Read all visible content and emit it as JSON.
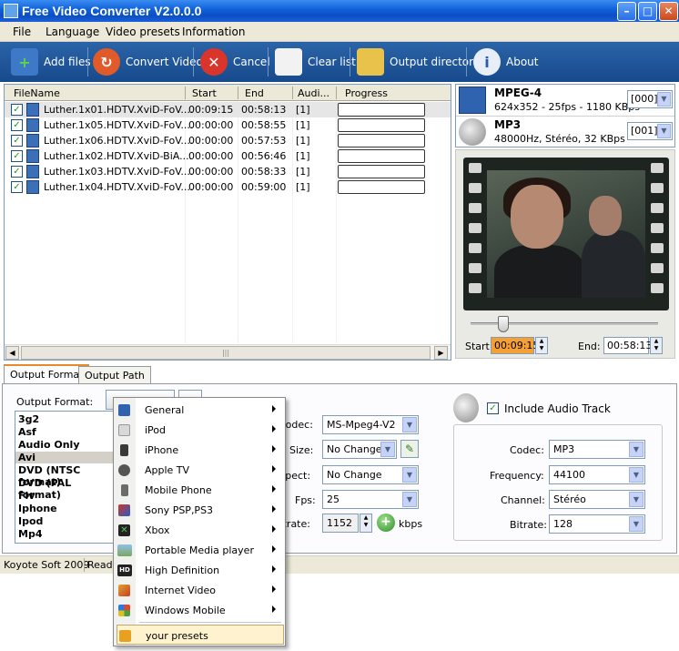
{
  "window": {
    "title": "Free Video Converter V2.0.0.0"
  },
  "menu": [
    "File",
    "Language",
    "Video presets",
    "Information"
  ],
  "toolbar": {
    "add_files": "Add files",
    "convert_video": "Convert Video",
    "cancel": "Cancel",
    "clear_list": "Clear list",
    "output_directory": "Output directory",
    "about": "About"
  },
  "filelist": {
    "columns": [
      "FileName",
      "Start",
      "End",
      "Audi...",
      "Progress"
    ],
    "rows": [
      {
        "name": "Luther.1x01.HDTV.XviD-FoV....",
        "start": "00:09:15",
        "end": "00:58:13",
        "audio": "[1]",
        "checked": "✓"
      },
      {
        "name": "Luther.1x05.HDTV.XviD-FoV....",
        "start": "00:00:00",
        "end": "00:58:55",
        "audio": "[1]",
        "checked": "✓"
      },
      {
        "name": "Luther.1x06.HDTV.XviD-FoV....",
        "start": "00:00:00",
        "end": "00:57:53",
        "audio": "[1]",
        "checked": "✓"
      },
      {
        "name": "Luther.1x02.HDTV.XviD-BiA....",
        "start": "00:00:00",
        "end": "00:56:46",
        "audio": "[1]",
        "checked": "✓"
      },
      {
        "name": "Luther.1x03.HDTV.XviD-FoV....",
        "start": "00:00:00",
        "end": "00:58:33",
        "audio": "[1]",
        "checked": "✓"
      },
      {
        "name": "Luther.1x04.HDTV.XviD-FoV....",
        "start": "00:00:00",
        "end": "00:59:00",
        "audio": "[1]",
        "checked": "✓"
      }
    ]
  },
  "streams": {
    "video": {
      "name": "MPEG-4",
      "desc": "624x352 - 25fps - 1180 KBps",
      "track": "[000]"
    },
    "audio": {
      "name": "MP3",
      "desc": "48000Hz, Stéréo, 32 KBps",
      "track": "[001]"
    }
  },
  "preview": {
    "start_label": "Start:",
    "start_value": "00:09:15",
    "end_label": "End:",
    "end_value": "00:58:13"
  },
  "tabs": {
    "output_format": "Output Format",
    "output_path": "Output Path"
  },
  "output": {
    "format_label": "Output Format:",
    "formats": [
      "3g2",
      "Asf",
      "Audio Only",
      "Avi",
      "DVD (NTSC format)",
      "DVD (PAL format)",
      "Flv",
      "Iphone",
      "Ipod",
      "Mp4"
    ],
    "selected_format": "Avi",
    "video": {
      "codec_label": "Codec:",
      "codec_value": "MS-Mpeg4-V2",
      "size_label": "Size:",
      "size_value": "No Change",
      "aspect_label": "Aspect:",
      "aspect_value": "No Change",
      "fps_label": "Fps:",
      "fps_value": "25",
      "bitrate_label": "Bitrate:",
      "bitrate_value": "1152",
      "bitrate_unit": "kbps"
    },
    "audio": {
      "include_label": "Include Audio Track",
      "codec_label": "Codec:",
      "codec_value": "MP3",
      "frequency_label": "Frequency:",
      "frequency_value": "44100",
      "channel_label": "Channel:",
      "channel_value": "Stéréo",
      "bitrate_label": "Bitrate:",
      "bitrate_value": "128"
    }
  },
  "statusbar": {
    "company": "Koyote Soft 2009",
    "status": "Read"
  },
  "presets_menu": [
    {
      "label": "General",
      "icon": "film-icon",
      "color": "#2f63b0"
    },
    {
      "label": "iPod",
      "icon": "ipod-icon",
      "color": "#d8d8d8"
    },
    {
      "label": "iPhone",
      "icon": "iphone-icon",
      "color": "#3a3a3a"
    },
    {
      "label": "Apple TV",
      "icon": "apple-icon",
      "color": "#555555"
    },
    {
      "label": "Mobile Phone",
      "icon": "mobile-phone-icon",
      "color": "#6b6b6b"
    },
    {
      "label": "Sony PSP,PS3",
      "icon": "playstation-icon",
      "color": "#c83a2a"
    },
    {
      "label": "Xbox",
      "icon": "xbox-icon",
      "color": "#2c7a2c"
    },
    {
      "label": "Portable Media player",
      "icon": "media-player-icon",
      "color": "#8aa870"
    },
    {
      "label": "High Definition",
      "icon": "hd-icon",
      "color": "#222222"
    },
    {
      "label": "Internet Video",
      "icon": "internet-video-icon",
      "color": "#e0a030"
    },
    {
      "label": "Windows Mobile",
      "icon": "windows-icon",
      "color": "#3aa040"
    }
  ],
  "presets_custom": {
    "label": "your presets",
    "icon": "user-presets-icon",
    "color": "#e8a020"
  }
}
